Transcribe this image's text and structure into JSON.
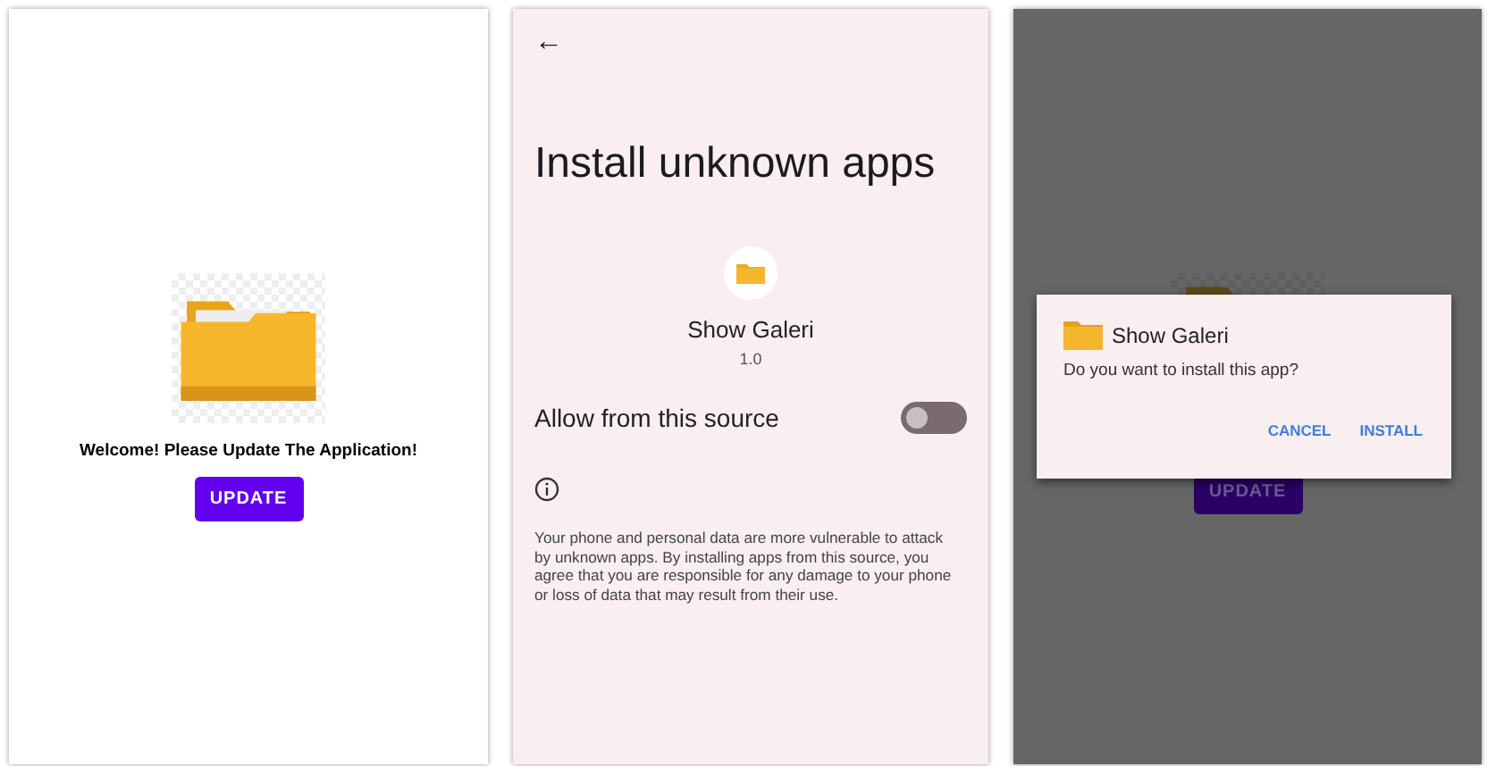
{
  "screens": [
    {
      "kind": "app",
      "welcome": "Welcome! Please Update The Application!",
      "button": "UPDATE"
    },
    {
      "kind": "settings",
      "back": "←",
      "title": "Install unknown apps",
      "app_name": "Show Galeri",
      "version": "1.0",
      "toggle_label": "Allow from this source",
      "toggle_on": false,
      "info": "Your phone and personal data are more vulnerable to attack by unknown apps. By installing apps from this source, you agree that you are responsible for any damage to your phone or loss of data that may result from their use."
    },
    {
      "kind": "dialog",
      "button": "UPDATE",
      "dialog": {
        "title": "Show Galeri",
        "message": "Do you want to install this app?",
        "actions": [
          "CANCEL",
          "INSTALL"
        ]
      }
    }
  ]
}
